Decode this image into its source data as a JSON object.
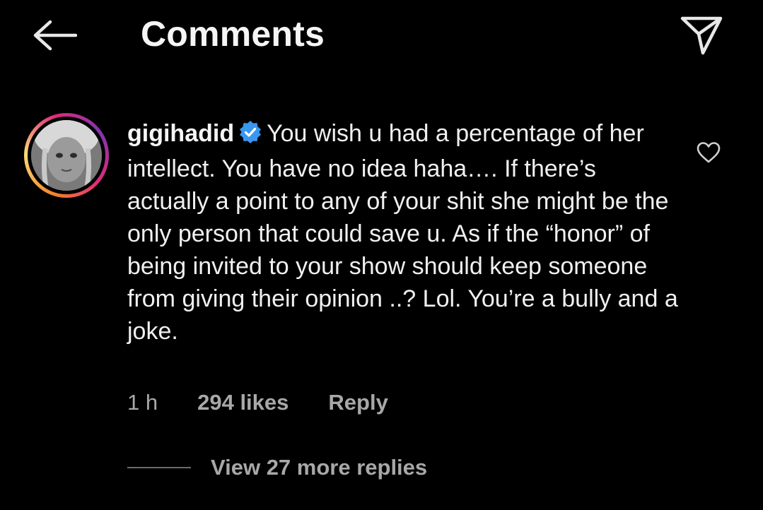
{
  "header": {
    "title": "Comments",
    "back_icon": "arrow-left-icon",
    "share_icon": "paper-plane-icon"
  },
  "comment": {
    "username": "gigihadid",
    "verified": true,
    "text": "You wish u had a percentage of her intellect. You have no idea haha…. If there’s actually a point to any of your shit she might be the only person that could save u. As if the “honor” of being invited to your show should keep someone from giving their opinion ..? Lol. You’re a bully and a joke.",
    "time": "1 h",
    "likes": "294 likes",
    "reply_label": "Reply",
    "view_replies": "View 27 more replies"
  },
  "colors": {
    "background": "#000000",
    "verified_badge": "#3897f0",
    "secondary_text": "#a8a8a8"
  }
}
